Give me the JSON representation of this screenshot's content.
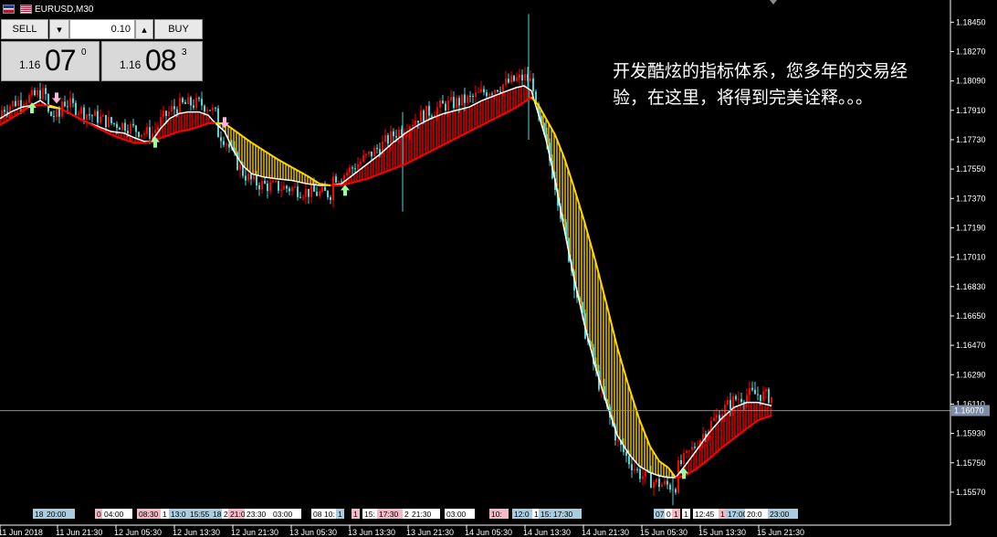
{
  "window": {
    "title": "EURUSD,M30"
  },
  "trade_panel": {
    "sell_label": "SELL",
    "buy_label": "BUY",
    "lot_value": "0.10",
    "down_arrow": "▾",
    "up_arrow": "▴",
    "sell_price": {
      "prefix": "1.16",
      "big": "07",
      "sup": "0"
    },
    "buy_price": {
      "prefix": "1.16",
      "big": "08",
      "sup": "3"
    }
  },
  "annotation": {
    "text": "开发酷炫的指标体系，您多年的交易经验，在这里，将得到完美诠释。。。"
  },
  "colors": {
    "background": "#000000",
    "bull_candle": "#ff0000",
    "bear_candle": "#55d3d3",
    "bull_fill": "#ff0000",
    "bear_fill": "#ffd700",
    "ma_line": "#ffffff",
    "axis_text": "#ffffff",
    "current_price_line": "#7f8ea8"
  },
  "chart_data": {
    "type": "candlestick",
    "symbol": "EURUSD",
    "timeframe": "M30",
    "current_price": "1.16070",
    "ylim": [
      1.1548,
      1.1853
    ],
    "y_ticks": [
      "1.18450",
      "1.18270",
      "1.18090",
      "1.17910",
      "1.17730",
      "1.17550",
      "1.17370",
      "1.17190",
      "1.17010",
      "1.16830",
      "1.16650",
      "1.16470",
      "1.16290",
      "1.16110",
      "1.15930",
      "1.15750",
      "1.15570"
    ],
    "x_labels": [
      "11 Jun 2018",
      "11 Jun 21:30",
      "12 Jun 05:30",
      "12 Jun 13:30",
      "12 Jun 21:30",
      "13 Jun 05:30",
      "13 Jun 13:30",
      "13 Jun 21:30",
      "14 Jun 05:30",
      "14 Jun 13:30",
      "14 Jun 21:30",
      "15 Jun 05:30",
      "15 Jun 13:30",
      "15 Jun 21:30"
    ],
    "event_tags": [
      {
        "label": "18",
        "color": "#a9cde0"
      },
      {
        "label": "20:00",
        "color": "#a9cde0"
      },
      {
        "label": "0",
        "color": "#f4b9c6"
      },
      {
        "label": "04:00",
        "color": "#ffffff"
      },
      {
        "label": "08:30",
        "color": "#f4b9c6"
      },
      {
        "label": "1",
        "color": "#ffffff"
      },
      {
        "label": "13:0",
        "color": "#a9cde0"
      },
      {
        "label": "15:55",
        "color": "#a9cde0"
      },
      {
        "label": "18",
        "color": "#a9cde0"
      },
      {
        "label": "2",
        "color": "#ffffff"
      },
      {
        "label": "21:0",
        "color": "#f4b9c6"
      },
      {
        "label": "23:30",
        "color": "#ffffff"
      },
      {
        "label": "03:00",
        "color": "#ffffff"
      },
      {
        "label": "08",
        "color": "#ffffff"
      },
      {
        "label": "10:",
        "color": "#ffffff"
      },
      {
        "label": "1",
        "color": "#a9cde0"
      },
      {
        "label": "1",
        "color": "#f4b9c6"
      },
      {
        "label": "15:",
        "color": "#ffffff"
      },
      {
        "label": "17:30",
        "color": "#f4b9c6"
      },
      {
        "label": "2",
        "color": "#ffffff"
      },
      {
        "label": "21:30",
        "color": "#ffffff"
      },
      {
        "label": "03:00",
        "color": "#ffffff"
      },
      {
        "label": "10:",
        "color": "#f4b9c6"
      },
      {
        "label": "12:0",
        "color": "#a9cde0"
      },
      {
        "label": "1",
        "color": "#ffffff"
      },
      {
        "label": "15:",
        "color": "#a9cde0"
      },
      {
        "label": "17:30",
        "color": "#a9cde0"
      },
      {
        "label": "07",
        "color": "#a9cde0"
      },
      {
        "label": "0",
        "color": "#ffffff"
      },
      {
        "label": "1",
        "color": "#f4b9c6"
      },
      {
        "label": "1",
        "color": "#ffffff"
      },
      {
        "label": "12:45",
        "color": "#ffffff"
      },
      {
        "label": "1",
        "color": "#f4b9c6"
      },
      {
        "label": "17:00",
        "color": "#a9cde0"
      },
      {
        "label": "20:0",
        "color": "#ffffff"
      },
      {
        "label": "23:00",
        "color": "#a9cde0"
      }
    ],
    "ma_path": [
      [
        0,
        1.1786
      ],
      [
        12,
        1.179
      ],
      [
        24,
        1.1793
      ],
      [
        34,
        1.1794
      ],
      [
        44,
        1.1797
      ],
      [
        54,
        1.1793
      ],
      [
        66,
        1.1792
      ],
      [
        80,
        1.1788
      ],
      [
        94,
        1.1784
      ],
      [
        108,
        1.1781
      ],
      [
        122,
        1.1778
      ],
      [
        136,
        1.1777
      ],
      [
        148,
        1.1774
      ],
      [
        158,
        1.1772
      ],
      [
        166,
        1.1772
      ],
      [
        176,
        1.178
      ],
      [
        186,
        1.1786
      ],
      [
        196,
        1.1789
      ],
      [
        206,
        1.179
      ],
      [
        218,
        1.179
      ],
      [
        228,
        1.1788
      ],
      [
        236,
        1.1783
      ],
      [
        246,
        1.1778
      ],
      [
        256,
        1.1766
      ],
      [
        266,
        1.1757
      ],
      [
        276,
        1.1752
      ],
      [
        290,
        1.175
      ],
      [
        304,
        1.1749
      ],
      [
        320,
        1.1748
      ],
      [
        336,
        1.1746
      ],
      [
        350,
        1.1745
      ],
      [
        362,
        1.1745
      ],
      [
        374,
        1.1746
      ],
      [
        388,
        1.1752
      ],
      [
        402,
        1.1758
      ],
      [
        416,
        1.1764
      ],
      [
        430,
        1.1771
      ],
      [
        444,
        1.1777
      ],
      [
        458,
        1.1782
      ],
      [
        472,
        1.1786
      ],
      [
        486,
        1.1789
      ],
      [
        500,
        1.1791
      ],
      [
        514,
        1.1793
      ],
      [
        528,
        1.1797
      ],
      [
        542,
        1.18
      ],
      [
        556,
        1.1803
      ],
      [
        566,
        1.1805
      ],
      [
        574,
        1.1806
      ],
      [
        582,
        1.1803
      ],
      [
        590,
        1.1788
      ],
      [
        598,
        1.1773
      ],
      [
        608,
        1.1748
      ],
      [
        618,
        1.1718
      ],
      [
        628,
        1.169
      ],
      [
        640,
        1.166
      ],
      [
        652,
        1.1634
      ],
      [
        664,
        1.1612
      ],
      [
        676,
        1.1592
      ],
      [
        688,
        1.1581
      ],
      [
        700,
        1.1573
      ],
      [
        712,
        1.1569
      ],
      [
        722,
        1.1567
      ],
      [
        732,
        1.1566
      ],
      [
        740,
        1.1566
      ],
      [
        750,
        1.1573
      ],
      [
        762,
        1.1582
      ],
      [
        776,
        1.1593
      ],
      [
        790,
        1.1602
      ],
      [
        804,
        1.1609
      ],
      [
        818,
        1.1612
      ],
      [
        830,
        1.1612
      ],
      [
        845,
        1.161
      ]
    ],
    "band_path": [
      [
        0,
        1.1782
      ],
      [
        12,
        1.1786
      ],
      [
        24,
        1.179
      ],
      [
        34,
        1.1794
      ],
      [
        44,
        1.1794
      ],
      [
        54,
        1.1794
      ],
      [
        66,
        1.1792
      ],
      [
        80,
        1.1788
      ],
      [
        94,
        1.1784
      ],
      [
        108,
        1.178
      ],
      [
        122,
        1.1776
      ],
      [
        136,
        1.1773
      ],
      [
        148,
        1.1771
      ],
      [
        158,
        1.1771
      ],
      [
        166,
        1.1772
      ],
      [
        176,
        1.1774
      ],
      [
        186,
        1.1776
      ],
      [
        196,
        1.1778
      ],
      [
        206,
        1.1779
      ],
      [
        218,
        1.1781
      ],
      [
        228,
        1.1783
      ],
      [
        236,
        1.1783
      ],
      [
        246,
        1.1783
      ],
      [
        256,
        1.1779
      ],
      [
        266,
        1.1775
      ],
      [
        276,
        1.1771
      ],
      [
        290,
        1.1766
      ],
      [
        304,
        1.1761
      ],
      [
        320,
        1.1756
      ],
      [
        336,
        1.1751
      ],
      [
        350,
        1.1746
      ],
      [
        362,
        1.1745
      ],
      [
        374,
        1.1745
      ],
      [
        388,
        1.1747
      ],
      [
        402,
        1.1749
      ],
      [
        416,
        1.1752
      ],
      [
        430,
        1.1755
      ],
      [
        444,
        1.1758
      ],
      [
        458,
        1.1762
      ],
      [
        472,
        1.1766
      ],
      [
        486,
        1.177
      ],
      [
        500,
        1.1774
      ],
      [
        514,
        1.1778
      ],
      [
        528,
        1.1782
      ],
      [
        542,
        1.1786
      ],
      [
        556,
        1.179
      ],
      [
        566,
        1.1793
      ],
      [
        574,
        1.1796
      ],
      [
        582,
        1.1799
      ],
      [
        590,
        1.1794
      ],
      [
        598,
        1.1786
      ],
      [
        608,
        1.1776
      ],
      [
        618,
        1.1762
      ],
      [
        628,
        1.1745
      ],
      [
        640,
        1.1723
      ],
      [
        652,
        1.1699
      ],
      [
        664,
        1.1673
      ],
      [
        676,
        1.1646
      ],
      [
        688,
        1.1623
      ],
      [
        700,
        1.1602
      ],
      [
        712,
        1.1585
      ],
      [
        722,
        1.1576
      ],
      [
        732,
        1.1572
      ],
      [
        740,
        1.1566
      ],
      [
        750,
        1.1567
      ],
      [
        762,
        1.1571
      ],
      [
        776,
        1.1577
      ],
      [
        790,
        1.1584
      ],
      [
        804,
        1.159
      ],
      [
        818,
        1.1596
      ],
      [
        830,
        1.1601
      ],
      [
        845,
        1.1604
      ]
    ],
    "signal_arrows": [
      {
        "x": 35,
        "price": 1.17925,
        "dir": "up"
      },
      {
        "x": 62,
        "price": 1.17985,
        "dir": "down"
      },
      {
        "x": 170,
        "price": 1.17715,
        "dir": "up"
      },
      {
        "x": 246,
        "price": 1.17835,
        "dir": "down"
      },
      {
        "x": 378,
        "price": 1.1742,
        "dir": "up"
      },
      {
        "x": 749,
        "price": 1.15685,
        "dir": "up"
      }
    ]
  }
}
